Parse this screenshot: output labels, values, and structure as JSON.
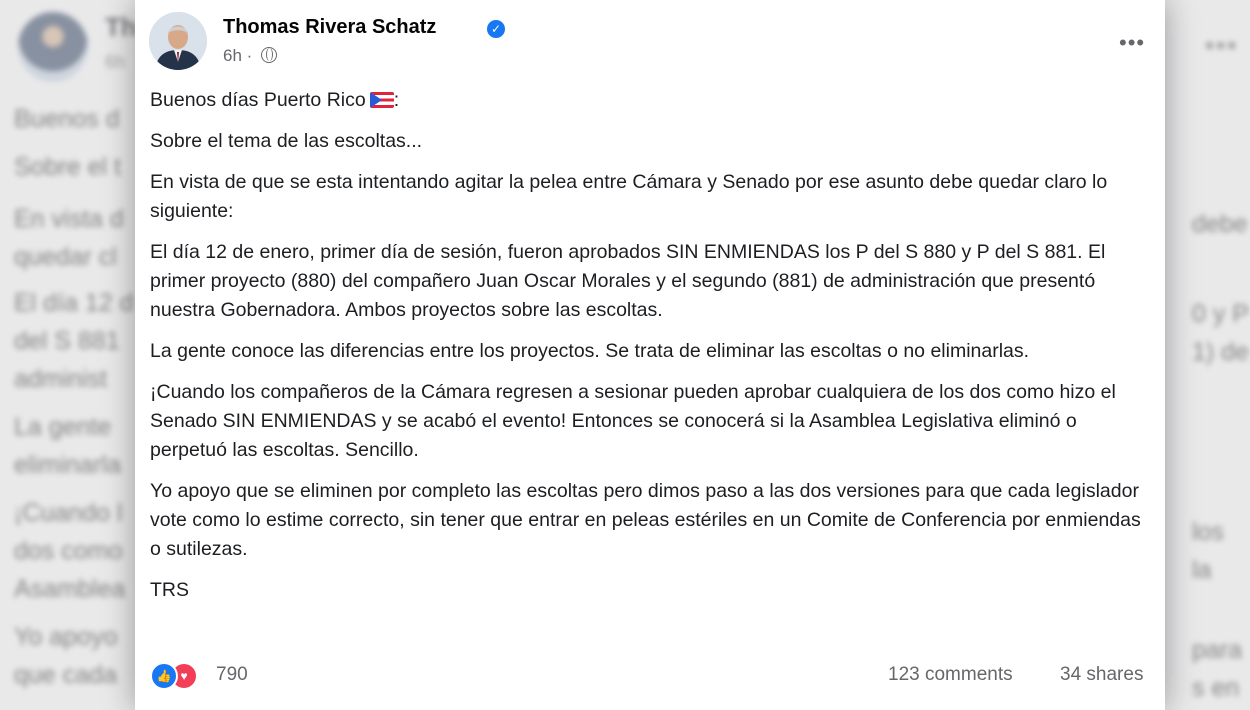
{
  "post": {
    "author": "Thomas Rivera Schatz",
    "time": "6h",
    "separator": "·",
    "more_label": "•••",
    "greeting": "Buenos días Puerto Rico",
    "paragraphs": [
      "Sobre el tema de las escoltas...",
      "En vista de que se esta intentando agitar la pelea entre Cámara y Senado por ese asunto debe quedar claro lo siguiente:",
      "El día 12 de enero, primer día de sesión, fueron aprobados SIN ENMIENDAS los P del S 880 y P del S 881.  El primer proyecto (880) del compañero Juan Oscar Morales y el segundo (881) de administración que presentó nuestra Gobernadora. Ambos proyectos sobre las escoltas.",
      "La gente conoce las diferencias entre los proyectos. Se trata de eliminar las escoltas o no eliminarlas.",
      "¡Cuando los compañeros de la Cámara regresen a sesionar pueden aprobar cualquiera de los dos como hizo el Senado SIN ENMIENDAS y se acabó el evento! Entonces se conocerá si la Asamblea Legislativa eliminó o perpetuó las escoltas.  Sencillo.",
      "Yo apoyo que se eliminen por completo las escoltas pero dimos paso a las dos versiones para que cada legislador vote como lo estime correcto, sin tener que entrar en peleas estériles en un Comite de Conferencia por enmiendas o sutilezas.",
      "TRS"
    ],
    "reactions_count": "790",
    "comments": "123 comments",
    "shares": "34 shares"
  },
  "background": {
    "name_fragment": "Th",
    "time_fragment": "6h",
    "more_label": "•••",
    "left_fragments": [
      "Buenos d",
      "Sobre el t",
      "En vista d",
      "quedar cl",
      "El día 12 d",
      "del S 881",
      "administ",
      "La gente",
      "eliminarla",
      "¡Cuando l",
      "dos como",
      "Asamblea",
      "Yo apoyo",
      "que cada"
    ],
    "right_fragments": [
      "debe",
      "0 y P",
      "1) de",
      "los",
      "la",
      "para",
      "s en un"
    ]
  },
  "colors": {
    "accent": "#1877f2",
    "love": "#f33e58",
    "muted_text": "#65676b"
  }
}
